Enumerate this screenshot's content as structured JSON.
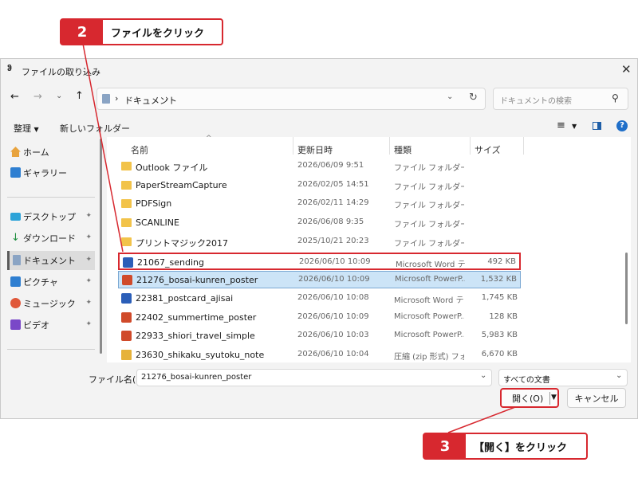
{
  "callouts": [
    {
      "num": "2",
      "text": "ファイルをクリック"
    },
    {
      "num": "3",
      "text": "【開く】をクリック"
    }
  ],
  "dialog": {
    "title": "ファイルの取り込み",
    "path": [
      "ドキュメント"
    ],
    "search_placeholder": "ドキュメントの検索",
    "toolbar": {
      "organize": "整理",
      "new_folder": "新しいフォルダー"
    },
    "sidebar": [
      {
        "label": "ホーム",
        "icon": "home-icon",
        "pinned": false
      },
      {
        "label": "ギャラリー",
        "icon": "gallery-icon",
        "pinned": false
      },
      {
        "label": "デスクトップ",
        "icon": "desktop-icon",
        "pinned": true
      },
      {
        "label": "ダウンロード",
        "icon": "download-icon",
        "pinned": true
      },
      {
        "label": "ドキュメント",
        "icon": "documents-icon",
        "pinned": true,
        "selected": true
      },
      {
        "label": "ピクチャ",
        "icon": "pictures-icon",
        "pinned": true
      },
      {
        "label": "ミュージック",
        "icon": "music-icon",
        "pinned": true
      },
      {
        "label": "ビデオ",
        "icon": "video-icon",
        "pinned": true
      }
    ],
    "columns": {
      "name": "名前",
      "date": "更新日時",
      "type": "種類",
      "size": "サイズ"
    },
    "files": [
      {
        "name": "Outlook ファイル",
        "date": "2026/06/09 9:51",
        "type": "ファイル フォルダー",
        "size": "",
        "kind": "folder"
      },
      {
        "name": "PaperStreamCapture",
        "date": "2026/02/05 14:51",
        "type": "ファイル フォルダー",
        "size": "",
        "kind": "folder"
      },
      {
        "name": "PDFSign",
        "date": "2026/02/11 14:29",
        "type": "ファイル フォルダー",
        "size": "",
        "kind": "folder"
      },
      {
        "name": "SCANLINE",
        "date": "2026/06/08 9:35",
        "type": "ファイル フォルダー",
        "size": "",
        "kind": "folder"
      },
      {
        "name": "プリントマジック2017",
        "date": "2025/10/21 20:23",
        "type": "ファイル フォルダー",
        "size": "",
        "kind": "folder"
      },
      {
        "name": "21067_sending",
        "date": "2026/06/10 10:09",
        "type": "Microsoft Word テ...",
        "size": "492 KB",
        "kind": "word"
      },
      {
        "name": "21276_bosai-kunren_poster",
        "date": "2026/06/10 10:09",
        "type": "Microsoft PowerP...",
        "size": "1,532 KB",
        "kind": "ppt"
      },
      {
        "name": "22381_postcard_ajisai",
        "date": "2026/06/10 10:08",
        "type": "Microsoft Word テ...",
        "size": "1,745 KB",
        "kind": "word"
      },
      {
        "name": "22402_summertime_poster",
        "date": "2026/06/10 10:09",
        "type": "Microsoft PowerP...",
        "size": "128 KB",
        "kind": "ppt"
      },
      {
        "name": "22933_shiori_travel_simple",
        "date": "2026/06/10 10:03",
        "type": "Microsoft PowerP...",
        "size": "5,983 KB",
        "kind": "ppt"
      },
      {
        "name": "23630_shikaku_syutoku_note",
        "date": "2026/06/10 10:04",
        "type": "圧縮 (zip 形式) フォ...",
        "size": "6,670 KB",
        "kind": "zip"
      }
    ],
    "filename_label": "ファイル名(N):",
    "filename_value": "21276_bosai-kunren_poster",
    "filter_value": "すべての文書",
    "open_label": "開く(O)",
    "cancel_label": "キャンセル"
  },
  "colors": {
    "accent": "#d7282f",
    "selection": "#cce4f7"
  }
}
